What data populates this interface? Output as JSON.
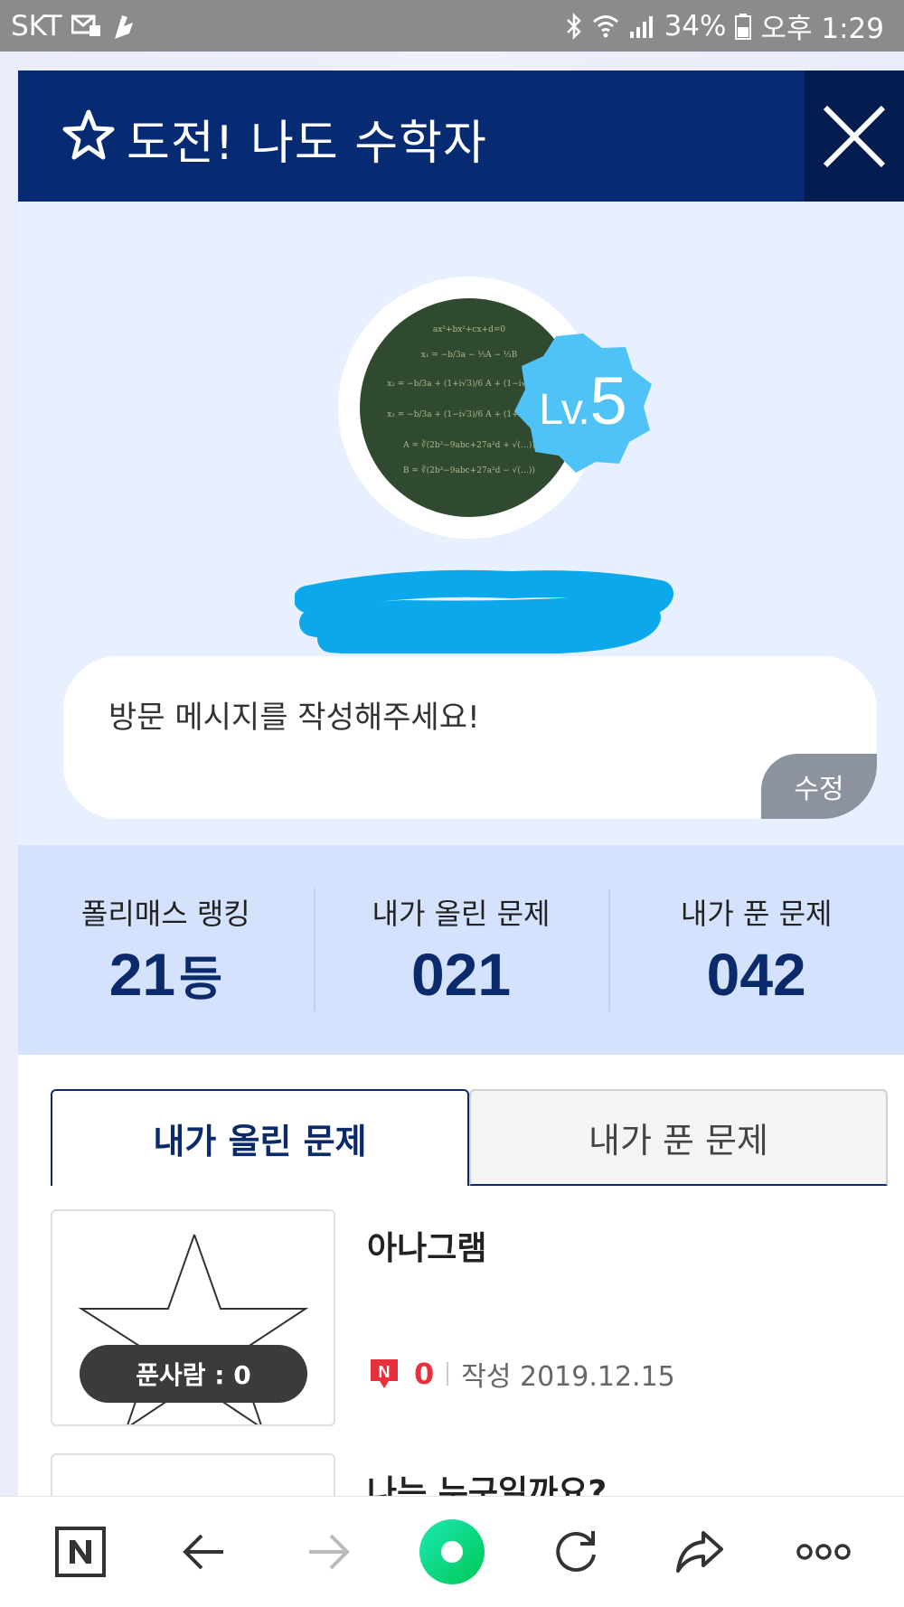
{
  "status_bar": {
    "carrier": "SKT",
    "battery": "34%",
    "time": "오후 1:29"
  },
  "header": {
    "title": "도전! 나도 수학자",
    "icon": "star-icon",
    "close_icon": "close-icon"
  },
  "profile": {
    "level_prefix": "Lv.",
    "level": "5",
    "message_placeholder": "방문 메시지를 작성해주세요!",
    "edit_label": "수정"
  },
  "stats": [
    {
      "label": "폴리매스 랭킹",
      "value": "21",
      "suffix": "등"
    },
    {
      "label": "내가 올린 문제",
      "value": "021",
      "suffix": ""
    },
    {
      "label": "내가 푼 문제",
      "value": "042",
      "suffix": ""
    }
  ],
  "tabs": [
    {
      "label": "내가 올린 문제",
      "active": true
    },
    {
      "label": "내가 푼 문제",
      "active": false
    }
  ],
  "problems": [
    {
      "title": "아나그램",
      "solvers": "푼사람 : 0",
      "comment_count": "0",
      "date": "작성 2019.12.15"
    },
    {
      "title": "나는 누구일까요?"
    }
  ],
  "colors": {
    "header_bg": "#062b73",
    "accent_navy": "#0b2a6b",
    "level_badge": "#4fc3f7",
    "stats_bg": "#d5e2fd",
    "comment_red": "#e8303a"
  },
  "bottom_bar": {
    "icons": [
      "naver-icon",
      "back-arrow-icon",
      "forward-arrow-icon",
      "home-circle-icon",
      "refresh-icon",
      "share-icon",
      "more-icon"
    ]
  }
}
